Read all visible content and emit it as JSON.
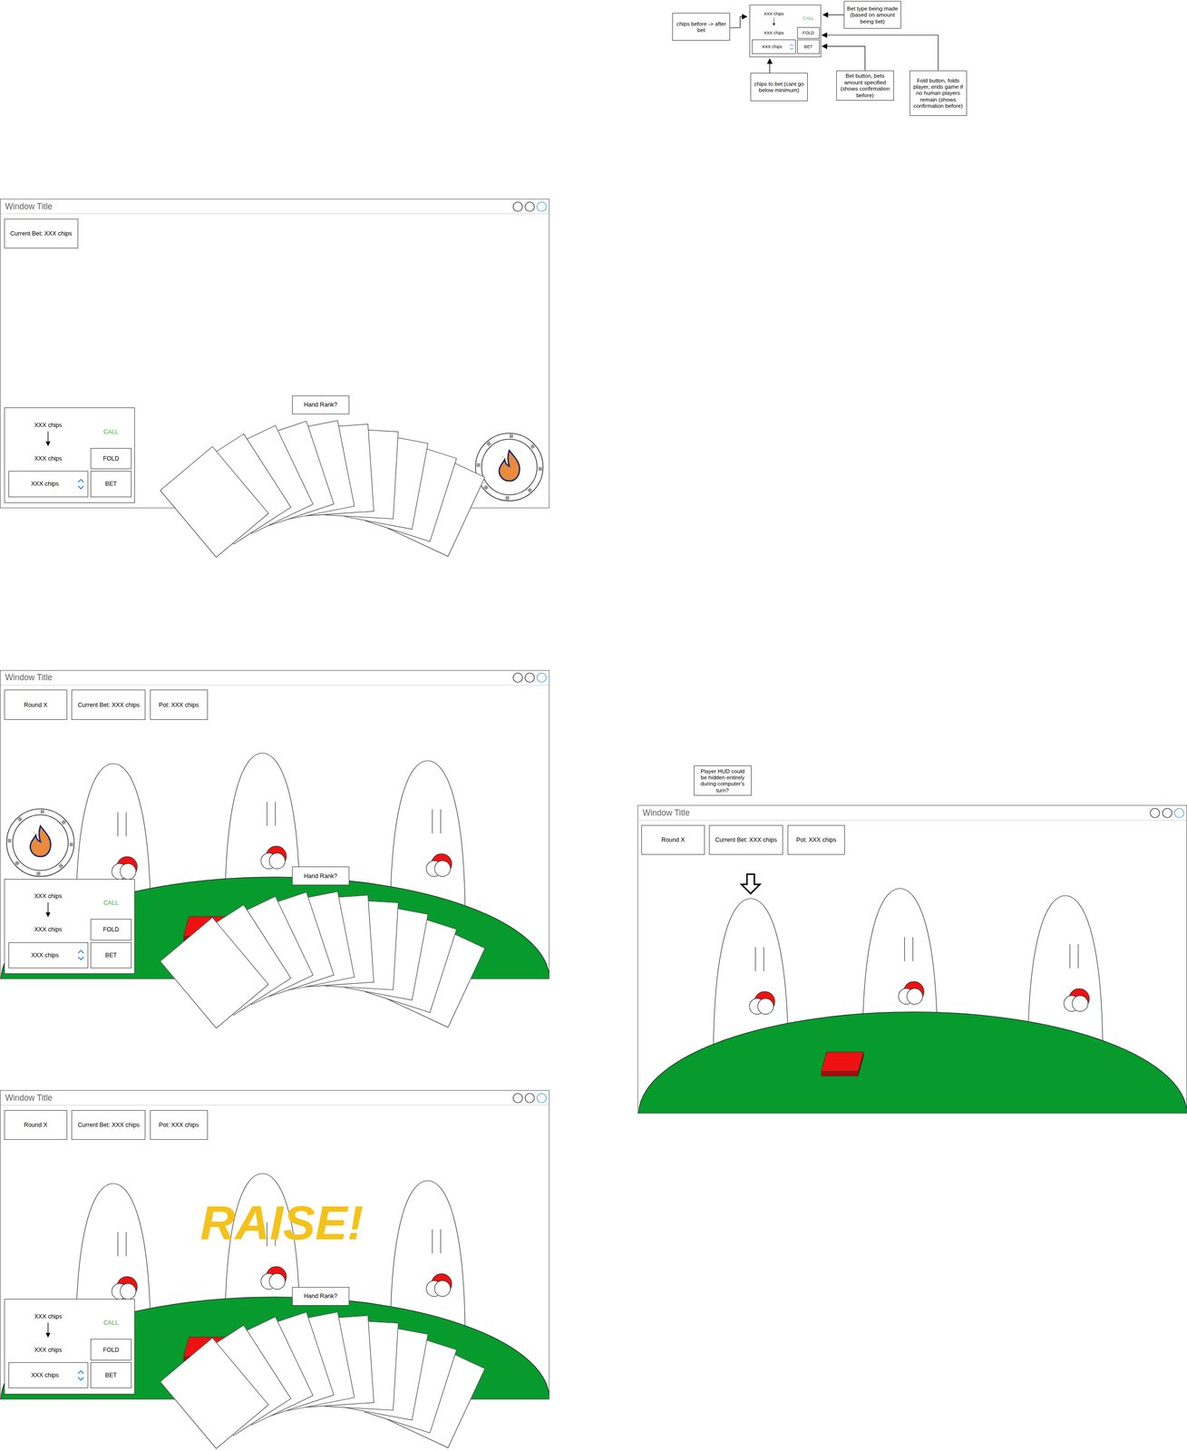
{
  "hud_diagram": {
    "hud": {
      "chips_before": "XXX chips",
      "chips_after": "XXX chips",
      "bet_type": "CALL",
      "fold_button": "FOLD",
      "bet_input": "XXX chips",
      "bet_button": "BET"
    },
    "notes": [
      "chips before -> after bet",
      "Bet type being made (based on amount being bet)",
      "chips to bet (cant go below minimum)",
      "Bet button, bets amount specified (shows confirmation before)",
      "Fold button, folds player, ends game if no human players remain (shows confirmation before)"
    ]
  },
  "turn_note": "Player HUD could be hidden entirely during computer's turn?",
  "windows": [
    {
      "title": "Window Title",
      "stats": [
        "Current Bet: XXX chips"
      ],
      "table": false,
      "opponents": [],
      "chip_icon": "right",
      "hand": {
        "rank": "Hand Rank?",
        "cards": 10
      },
      "hud": {
        "chips_before": "XXX chips",
        "chips_after": "XXX chips",
        "bet_type": "CALL",
        "fold_button": "FOLD",
        "bet_input": "XXX chips",
        "bet_button": "BET"
      }
    },
    {
      "title": "Window Title",
      "stats": [
        "Round X",
        "Current Bet: XXX chips",
        "Pot: XXX chips"
      ],
      "table": true,
      "opponents": [
        {
          "turn": false
        },
        {
          "turn": false
        },
        {
          "turn": false
        }
      ],
      "chip_icon": "left",
      "hand": {
        "rank": "Hand Rank?",
        "cards": 10
      },
      "hud": {
        "chips_before": "XXX chips",
        "chips_after": "XXX chips",
        "bet_type": "CALL",
        "fold_button": "FOLD",
        "bet_input": "XXX chips",
        "bet_button": "BET"
      }
    },
    {
      "title": "Window Title",
      "stats": [
        "Round X",
        "Current Bet: XXX chips",
        "Pot: XXX chips"
      ],
      "table": true,
      "opponents": [
        {
          "turn": false
        },
        {
          "turn": false
        },
        {
          "turn": false
        }
      ],
      "banner": "RAISE!",
      "hand": {
        "rank": "Hand Rank?",
        "cards": 10
      },
      "hud": {
        "chips_before": "XXX chips",
        "chips_after": "XXX chips",
        "bet_type": "CALL",
        "fold_button": "FOLD",
        "bet_input": "XXX chips",
        "bet_button": "BET"
      }
    },
    {
      "title": "Window Title",
      "stats": [
        "Round X",
        "Current Bet: XXX chips",
        "Pot: XXX chips"
      ],
      "table": true,
      "opponents": [
        {
          "turn": true
        },
        {
          "turn": false
        },
        {
          "turn": false
        }
      ]
    }
  ]
}
